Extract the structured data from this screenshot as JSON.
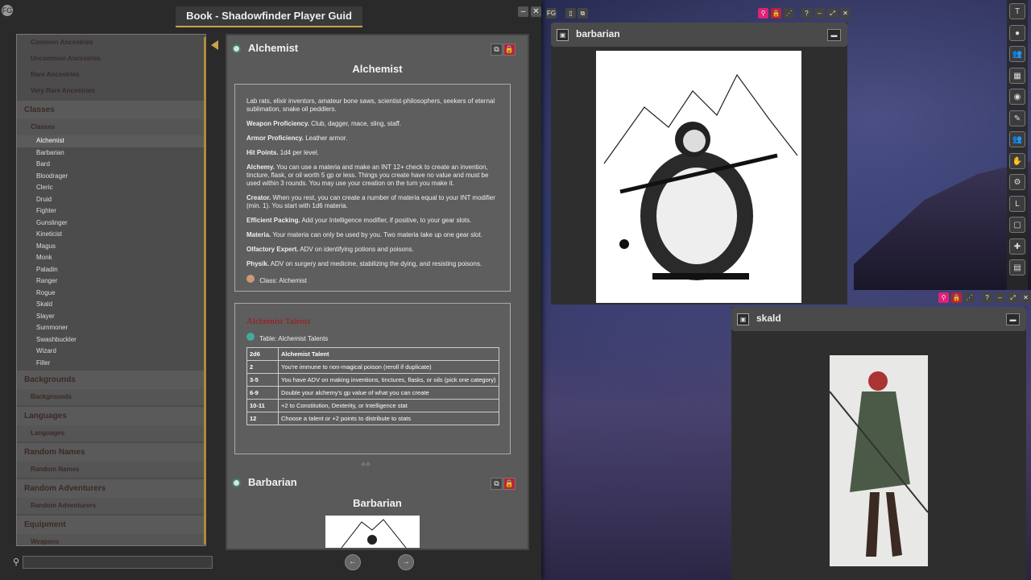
{
  "book": {
    "title": "Book - Shadowfinder Player Guid",
    "sidebar": {
      "top_items": [
        "Common Ancestries",
        "Uncommon Ancestries",
        "Rare Ancestries",
        "Very Rare Ancestries"
      ],
      "classes_header": "Classes",
      "classes_sub": "Classes",
      "class_items": [
        "Alchemist",
        "Barbarian",
        "Bard",
        "Bloodrager",
        "Cleric",
        "Druid",
        "Fighter",
        "Gunslinger",
        "Kineticist",
        "Magus",
        "Monk",
        "Paladin",
        "Ranger",
        "Rogue",
        "Skald",
        "Slayer",
        "Summoner",
        "Swashbuckler",
        "Wizard",
        "Filler"
      ],
      "groups": [
        {
          "header": "Backgrounds",
          "sub": "Backgrounds"
        },
        {
          "header": "Languages",
          "sub": "Languages"
        },
        {
          "header": "Random Names",
          "sub": "Random Names"
        },
        {
          "header": "Random Adventurers",
          "sub": "Random Adventurers"
        }
      ],
      "last_header": "Equipment",
      "last_cut": "Weapons"
    },
    "search": {
      "placeholder": ""
    },
    "entry1": {
      "title": "Alchemist",
      "subtitle": "Alchemist",
      "intro": "Lab rats, elixir inventors, amateur bone saws, scientist-philosophers, seekers of eternal sublimation, snake oil peddlers.",
      "features": [
        {
          "name": "Weapon Proficiency.",
          "text": " Club, dagger, mace, sling, staff."
        },
        {
          "name": "Armor Proficiency.",
          "text": " Leather armor."
        },
        {
          "name": "Hit Points.",
          "text": " 1d4 per level."
        },
        {
          "name": "Alchemy.",
          "text": " You can use a materia and make an INT 12+ check to create an invention, tincture, flask, or oil worth 5 gp or less. Things you create have no value and must be used within 3 rounds. You may use your creation on the turn you make it."
        },
        {
          "name": "Creator.",
          "text": " When you rest, you can create a number of materia equal to your INT modifier (min. 1). You start with 1d6 materia."
        },
        {
          "name": "Efficient Packing.",
          "text": " Add your Intelligence modifier, if positive, to your gear slots."
        },
        {
          "name": "Materia.",
          "text": " Your materia can only be used by you. Two materia take up one gear slot."
        },
        {
          "name": "Olfactory Expert.",
          "text": " ADV on identifying potions and poisons."
        },
        {
          "name": "Physik.",
          "text": " ADV on surgery and medicine, stabilizing the dying, and resisting poisons."
        }
      ],
      "class_link": "Class: Alchemist",
      "talents_title": "Alchemist Talents",
      "table_link": "Table: Alchemist Talents",
      "table": {
        "headers": [
          "2d6",
          "Alchemist Talent"
        ],
        "rows": [
          [
            "2",
            "You're immune to non-magical poison (reroll if duplicate)"
          ],
          [
            "3-5",
            "You have ADV on making inventions, tinctures, flasks, or oils (pick one category)"
          ],
          [
            "6-9",
            "Double your alchemy's gp value of what you can create"
          ],
          [
            "10-11",
            "+2 to Constitution, Dexterity, or Intelligence stat"
          ],
          [
            "12",
            "Choose a talent or +2 points to distribute to stats"
          ]
        ]
      }
    },
    "entry2": {
      "title": "Barbarian",
      "subtitle": "Barbarian"
    }
  },
  "image_windows": [
    {
      "title": "barbarian"
    },
    {
      "title": "skald"
    }
  ],
  "right_toolbar": [
    "T",
    "●",
    "👥",
    "▦",
    "◉",
    "✎",
    "👥",
    "✋",
    "⚙",
    "L",
    "▢",
    "✚",
    "▤"
  ],
  "colors": {
    "accent_gold": "#c9a34a",
    "talent_red": "#a31515",
    "lock_red": "#b23333"
  }
}
